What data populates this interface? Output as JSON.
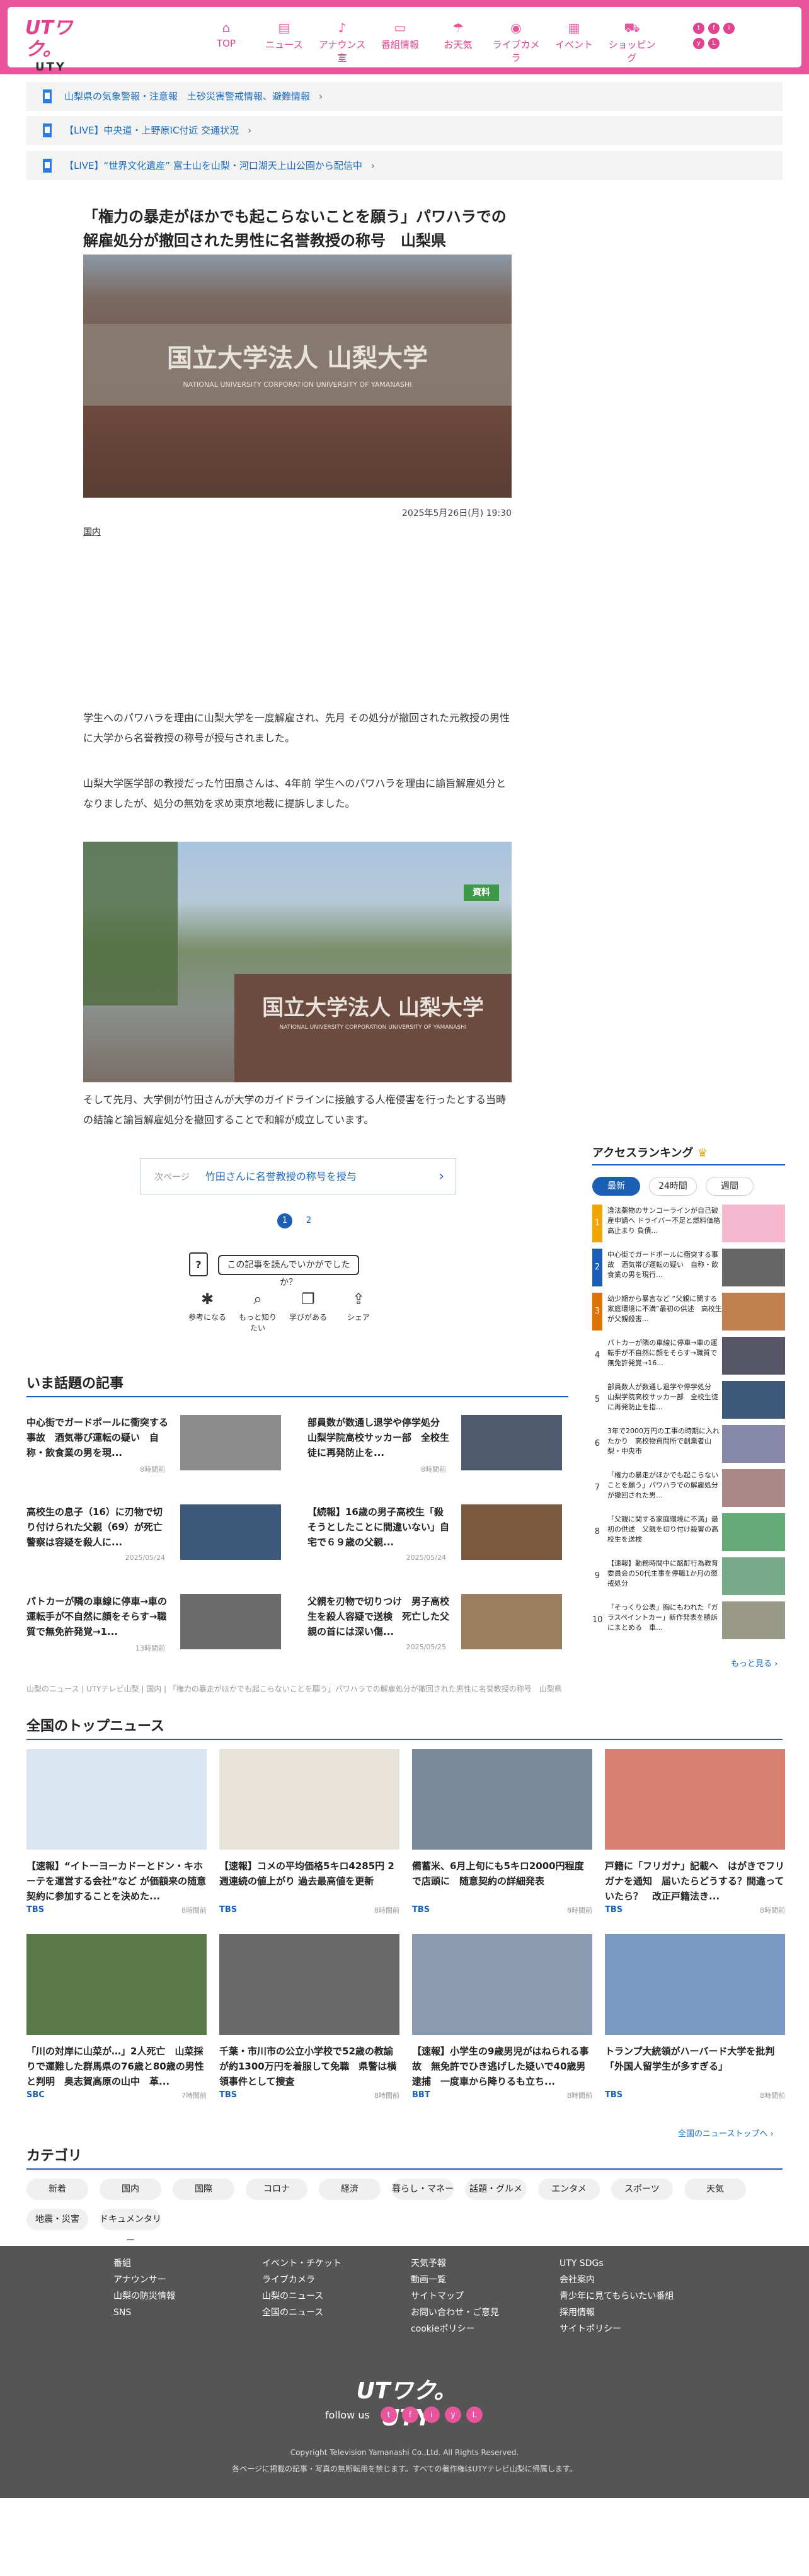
{
  "header": {
    "logo_top": "UTワク。",
    "logo_bottom": "UTY",
    "nav": [
      {
        "icon": "home-icon",
        "glyph": "⌂",
        "label": "TOP"
      },
      {
        "icon": "news-icon",
        "glyph": "▤",
        "label": "ニュース"
      },
      {
        "icon": "mic-icon",
        "glyph": "♪",
        "label": "アナウンス室"
      },
      {
        "icon": "tv-icon",
        "glyph": "▭",
        "label": "番組情報"
      },
      {
        "icon": "weather-icon",
        "glyph": "☂",
        "label": "お天気"
      },
      {
        "icon": "camera-icon",
        "glyph": "◉",
        "label": "ライブカメラ"
      },
      {
        "icon": "calendar-icon",
        "glyph": "▦",
        "label": "イベント"
      },
      {
        "icon": "cart-icon",
        "glyph": "⛟",
        "label": "ショッピング"
      }
    ],
    "social": [
      "t",
      "f",
      "i",
      "y",
      "L"
    ]
  },
  "alerts": [
    "山梨県の気象警報・注意報　土砂災害警戒情報、避難情報",
    "【LIVE】中央道・上野原IC付近 交通状況",
    "【LIVE】“世界文化遺産” 富士山を山梨・河口湖天上山公園から配信中"
  ],
  "article": {
    "title": "「権力の暴走がほかでも起こらないことを願う」パワハラでの解雇処分が撤回された男性に名誉教授の称号　山梨県",
    "date": "2025年5月26日(月) 19:30",
    "category": "国内",
    "photo1_text": "国立大学法人 山梨大学",
    "photo1_sub": "NATIONAL UNIVERSITY CORPORATION  UNIVERSITY OF YAMANASHI",
    "photo2_text": "国立大学法人 山梨大学",
    "photo2_sub": "NATIONAL UNIVERSITY CORPORATION  UNIVERSITY OF YAMANASHI",
    "photo2_badge": "資料",
    "p1": "学生へのパワハラを理由に山梨大学を一度解雇され、先月 その処分が撤回された元教授の男性に大学から名誉教授の称号が授与されました。",
    "p2": "山梨大学医学部の教授だった竹田扇さんは、4年前 学生へのパワハラを理由に諭旨解雇処分となりましたが、処分の無効を求め東京地裁に提訴しました。",
    "p3": "そして先月、大学側が竹田さんが大学のガイドラインに接触する人権侵害を行ったとする当時の結論と諭旨解雇処分を撤回することで和解が成立しています。",
    "next_label": "次ページ",
    "next_link": "竹田さんに名誉教授の称号を授与",
    "pages": [
      "1",
      "2"
    ],
    "question": "この記事を読んでいかがでしたか？",
    "qmark": "?",
    "reactions": [
      {
        "icon": "bulb-icon",
        "glyph": "✱",
        "label": "参考になる"
      },
      {
        "icon": "magnifier-icon",
        "glyph": "⌕",
        "label": "もっと知りたい"
      },
      {
        "icon": "book-icon",
        "glyph": "❐",
        "label": "学びがある"
      },
      {
        "icon": "share-icon",
        "glyph": "⇪",
        "label": "シェア"
      }
    ]
  },
  "trending": {
    "heading": "いま話題の記事",
    "items": [
      {
        "title": "中心街でガードポールに衝突する事故　酒気帯び運転の疑い　自称・飲食業の男を現...",
        "date": "8時間前"
      },
      {
        "title": "部員数が数通し退学や停学処分　山梨学院高校サッカー部　全校生徒に再発防止を...",
        "date": "8時間前"
      },
      {
        "title": "高校生の息子（16）に刃物で切り付けられた父親（69）が死亡　警察は容疑を殺人に...",
        "date": "2025/05/24"
      },
      {
        "title": "【続報】16歳の男子高校生「殺そうとしたことに間違いない」自宅で６９歳の父親...",
        "date": "2025/05/24"
      },
      {
        "title": "パトカーが隣の車線に停車→車の運転手が不自然に顔をそらす→職質で無免許発覚→1...",
        "date": "13時間前"
      },
      {
        "title": "父親を刃物で切りつけ　男子高校生を殺人容疑で送検　死亡した父親の首には深い傷...",
        "date": "2025/05/25"
      }
    ]
  },
  "breadcrumb": "山梨のニュース | UTYテレビ山梨 | 国内 | 「権力の暴走がほかでも起こらないことを願う」パワハラでの解雇処分が撤回された男性に名誉教授の称号　山梨県",
  "ranking": {
    "heading": "アクセスランキング",
    "tabs": [
      "最新",
      "24時間",
      "週間"
    ],
    "items": [
      {
        "n": "1",
        "t": "違法薬物のサンコーラインが自己破産申請へ ドライバー不足と燃料価格高止まり 負債..."
      },
      {
        "n": "2",
        "t": "中心街でガードポールに衝突する事故　酒気帯び運転の疑い　自称・飲食業の男を現行..."
      },
      {
        "n": "3",
        "t": "幼少期から暴言など “父親に関する家庭環境に不満”最初の供述　高校生が父親殺害..."
      },
      {
        "n": "4",
        "t": "パトカーが隣の車線に停車→車の運転手が不自然に顔をそらす→職質で無免許発覚→16..."
      },
      {
        "n": "5",
        "t": "部員数人が数通し退学や停学処分　山梨学院高校サッカー部　全校生徒に再発防止を指..."
      },
      {
        "n": "6",
        "t": "3年で2000万円の工事の時期に入れたかり　高校物資問所で創業者山梨・中央市"
      },
      {
        "n": "7",
        "t": "「権力の暴走がほかでも起こらないことを願う」パワハラでの解雇処分が撤回された男..."
      },
      {
        "n": "8",
        "t": "「父親に関する家庭環境に不満」最初の供述　父親を切り付け殺害の高校生を送検"
      },
      {
        "n": "9",
        "t": "【速報】勤務時間中に酩酊行為教育委員会の50代主事を停職1か月の懲戒処分"
      },
      {
        "n": "10",
        "t": "「そっくり公表」胸にもわれた「ガラスペイントカー」新作発表を勝訴にまとめる　車..."
      }
    ],
    "more": "もっと見る ›"
  },
  "topnews": {
    "heading": "全国のトップニュース",
    "items": [
      {
        "title": "【速報】“イトーヨーカドーとドン・キホーテを運営する会社”など が価額来の随意契約に参加することを決めた...",
        "src": "TBS",
        "date": "8時間前"
      },
      {
        "title": "【速報】コメの平均価格5キロ4285円 2週連続の値上がり 過去最高値を更新",
        "src": "TBS",
        "date": "8時間前"
      },
      {
        "title": "備蓄米、6月上旬にも5キロ2000円程度で店頭に　随意契約の詳細発表",
        "src": "TBS",
        "date": "8時間前"
      },
      {
        "title": "戸籍に「フリガナ」記載へ　はがきでフリガナを通知　届いたらどうする？間違っていたら？　改正戸籍法き...",
        "src": "TBS",
        "date": "8時間前"
      },
      {
        "title": "「川の対岸に山菜が…」2人死亡　山菜採りで運難した群馬県の76歳と80歳の男性と判明　奥志賀高原の山中　革...",
        "src": "SBC",
        "date": "7時間前"
      },
      {
        "title": "千葉・市川市の公立小学校で52歳の教諭が約1300万円を着服して免職　県警は横領事件として捜査",
        "src": "TBS",
        "date": "8時間前"
      },
      {
        "title": "【速報】小学生の9歳男児がはねられる事故　無免許でひき逃げした疑いで40歳男逮捕　一度車から降りるも立ち...",
        "src": "BBT",
        "date": "8時間前"
      },
      {
        "title": "トランプ大統領がハーバード大学を批判「外国人留学生が多すぎる」",
        "src": "TBS",
        "date": "8時間前"
      }
    ],
    "more": "全国のニューストップへ ›"
  },
  "categories": {
    "heading": "カテゴリ",
    "items": [
      "新着",
      "国内",
      "国際",
      "コロナ",
      "経済",
      "暮らし・マネー",
      "話題・グルメ",
      "エンタメ",
      "スポーツ",
      "天気",
      "地震・災害",
      "ドキュメンタリー"
    ]
  },
  "footer": {
    "cols": [
      [
        "番組",
        "アナウンサー",
        "山梨の防災情報",
        "SNS"
      ],
      [
        "イベント・チケット",
        "ライブカメラ",
        "山梨のニュース",
        "全国のニュース"
      ],
      [
        "天気予報",
        "動画一覧",
        "サイトマップ",
        "お問い合わせ・ご意見",
        "cookieポリシー"
      ],
      [
        "UTY SDGs",
        "会社案内",
        "青少年に見てもらいたい番組",
        "採用情報",
        "サイトポリシー"
      ]
    ],
    "logo": "UTワク。UTY",
    "follow": "follow us",
    "copyright": "Copyright Television Yamanashi Co.,Ltd. All Rights Reserved.",
    "notice": "各ページに掲載の記事・写真の無断転用を禁じます。すべての著作権はUTYテレビ山梨に帰属します。"
  },
  "colors": {
    "brand": "#e9559c",
    "link": "#1a6bc4",
    "accent": "#1a5fb4",
    "footer": "#555555"
  }
}
